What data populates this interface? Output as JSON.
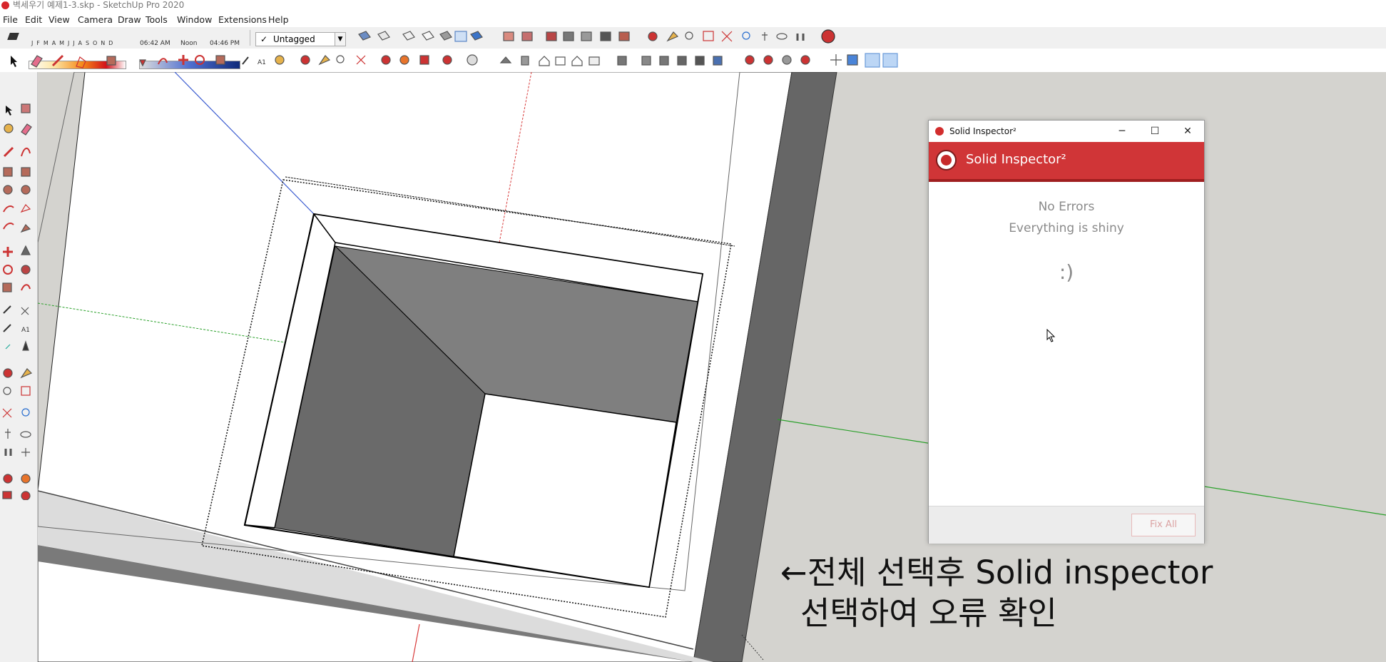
{
  "window": {
    "title": "벽세우기 예제1-3.skp - SketchUp Pro 2020"
  },
  "menu": [
    "File",
    "Edit",
    "View",
    "Camera",
    "Draw",
    "Tools",
    "Window",
    "Extensions",
    "Help"
  ],
  "shadow": {
    "months": "J F M A M J J A S O N D",
    "times": [
      "06:42 AM",
      "Noon",
      "04:46 PM"
    ]
  },
  "tag": {
    "check": "✓",
    "value": "Untagged"
  },
  "solid_inspector": {
    "window_title": "Solid Inspector²",
    "header_title": "Solid Inspector²",
    "message_line1": "No Errors",
    "message_line2": "Everything is shiny",
    "smiley": ":)",
    "fix_all_label": "Fix All",
    "controls": {
      "minimize": "─",
      "maximize": "☐",
      "close": "✕"
    }
  },
  "annotation": {
    "line1": "←전체 선택후 Solid inspector",
    "line2": "선택하여 오류 확인"
  },
  "colors": {
    "sketchup_red": "#d03537",
    "viewport_ground": "#d4d3cf",
    "axis_blue": "#3a5bd0",
    "axis_green": "#2aa02a",
    "axis_red": "#d83a3a"
  },
  "icons": {
    "toolbar1": [
      "sketchup-icon",
      "shadow-toggle-icon",
      "tag-dropdown-icon",
      "section-icons",
      "xray-style-icons",
      "component-icons",
      "camera-icons",
      "extension-icons"
    ],
    "toolbar2": [
      "select-icon",
      "eraser-icon",
      "pencil-icon",
      "shape-icon",
      "push-pull-icon",
      "move-icon",
      "measure-icons",
      "camera-nav-icons",
      "section-plane-icons",
      "warehouse-icons",
      "view-icons"
    ]
  }
}
